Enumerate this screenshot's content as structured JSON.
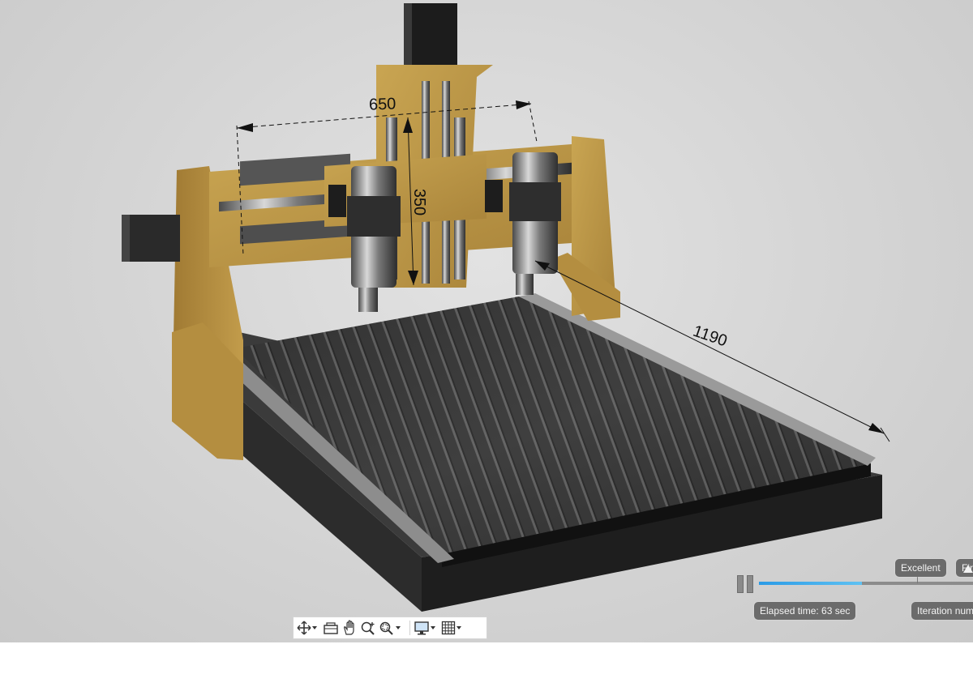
{
  "scene": {
    "description_icons": [
      "render-viewport"
    ],
    "dimensions": [
      {
        "id": "width",
        "label": "650"
      },
      {
        "id": "height",
        "label": "350"
      },
      {
        "id": "length",
        "label": "1190"
      }
    ]
  },
  "render": {
    "quality_levels": [
      "Excellent",
      "Fin"
    ],
    "progress": 0.48,
    "elapsed_label": "Elapsed time: 63 sec",
    "iteration_label": "Iteration num",
    "colors": {
      "progress": "#2b9be6",
      "badge": "#6b6b6b"
    }
  },
  "toolbar": {
    "icons": [
      "orbit-icon",
      "look-at-icon",
      "pan-icon",
      "zoom-icon",
      "zoom-window-icon",
      "display-settings-icon",
      "grid-icon"
    ]
  }
}
